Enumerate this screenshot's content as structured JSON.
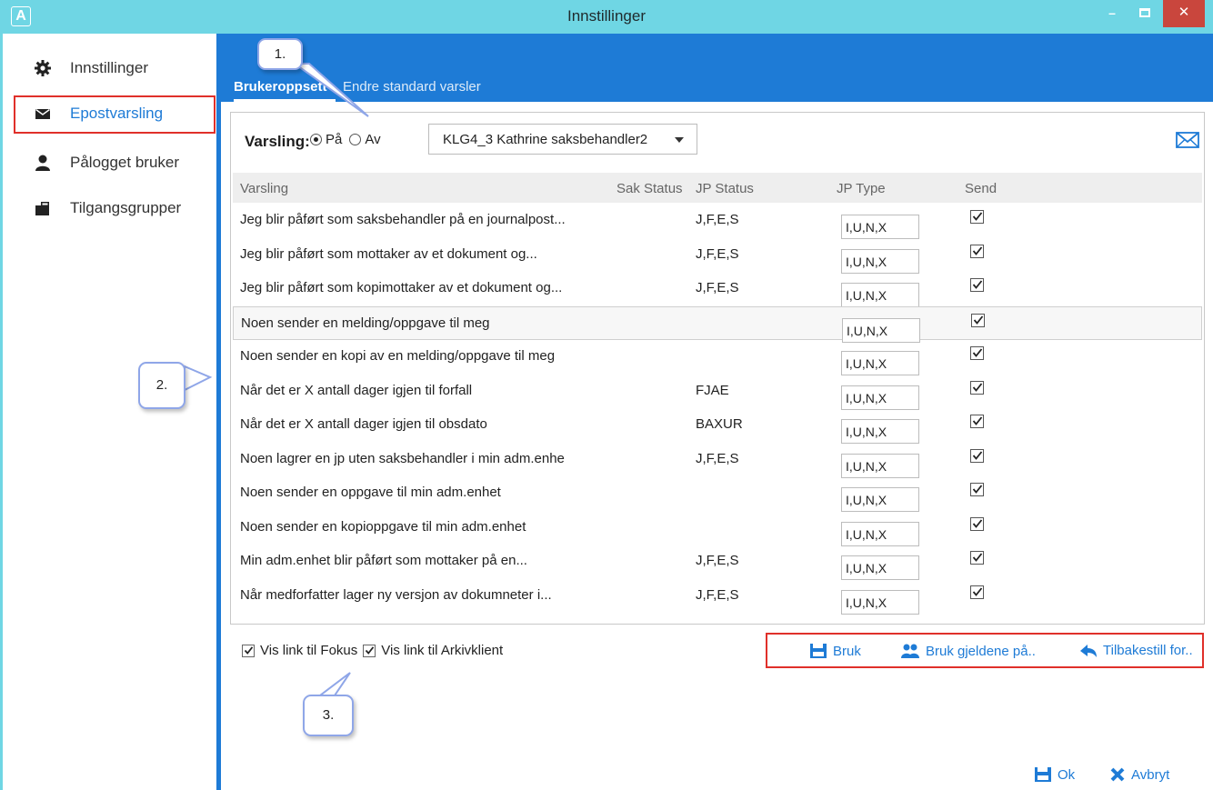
{
  "window": {
    "app_icon": "A",
    "title": "Innstillinger",
    "minimize": "–",
    "close": "✕"
  },
  "sidebar": {
    "items": [
      {
        "label": "Innstillinger",
        "icon": "gear-icon"
      },
      {
        "label": "Epostvarsling",
        "icon": "envelope-icon",
        "active": true
      },
      {
        "label": "Pålogget bruker",
        "icon": "user-icon"
      },
      {
        "label": "Tilgangsgrupper",
        "icon": "group-icon"
      }
    ]
  },
  "tabs": [
    {
      "label": "Brukeroppsett",
      "active": true
    },
    {
      "label": "Endre standard varsler"
    }
  ],
  "varsling": {
    "label": "Varsling:",
    "on_label": "På",
    "off_label": "Av",
    "selected": "på",
    "user": "KLG4_3  Kathrine saksbehandler2"
  },
  "table": {
    "headers": [
      "Varsling",
      "Sak Status",
      "JP Status",
      "JP Type",
      "Send"
    ],
    "rows": [
      {
        "text": "Jeg blir påført som saksbehandler på en journalpost...",
        "jp_status": "J,F,E,S",
        "jp_type": "I,U,N,X",
        "send": true
      },
      {
        "text": "Jeg blir påført som mottaker av et dokument og...",
        "jp_status": "J,F,E,S",
        "jp_type": "I,U,N,X",
        "send": true
      },
      {
        "text": "Jeg blir påført som kopimottaker av et dokument og...",
        "jp_status": "J,F,E,S",
        "jp_type": "I,U,N,X",
        "send": true
      },
      {
        "text": "Noen sender en melding/oppgave til meg",
        "jp_status": "",
        "jp_type": "I,U,N,X",
        "send": true,
        "highlight": true
      },
      {
        "text": "Noen sender en kopi av en melding/oppgave til meg",
        "jp_status": "",
        "jp_type": "I,U,N,X",
        "send": true
      },
      {
        "text": "Når det er X antall dager igjen til forfall",
        "jp_status": "FJAE",
        "jp_type": "I,U,N,X",
        "send": true
      },
      {
        "text": "Når det er X antall dager igjen til obsdato",
        "jp_status": "BAXUR",
        "jp_type": "I,U,N,X",
        "send": true
      },
      {
        "text": "Noen lagrer en jp uten saksbehandler i min adm.enhe",
        "jp_status": "J,F,E,S",
        "jp_type": "I,U,N,X",
        "send": true
      },
      {
        "text": "Noen sender en oppgave til min adm.enhet",
        "jp_status": "",
        "jp_type": "I,U,N,X",
        "send": true
      },
      {
        "text": "Noen sender en kopioppgave til min adm.enhet",
        "jp_status": "",
        "jp_type": "I,U,N,X",
        "send": true
      },
      {
        "text": "Min adm.enhet blir påført som mottaker på en...",
        "jp_status": "J,F,E,S",
        "jp_type": "I,U,N,X",
        "send": true
      },
      {
        "text": "Når medforfatter lager ny versjon av dokumneter i...",
        "jp_status": "J,F,E,S",
        "jp_type": "I,U,N,X",
        "send": true
      }
    ]
  },
  "footer": {
    "link_fokus": "Vis link til Fokus",
    "link_arkiv": "Vis link til Arkivklient",
    "bruk": "Bruk",
    "bruk_gjeldene": "Bruk gjeldene på..",
    "tilbakestill": "Tilbakestill for..",
    "ok": "Ok",
    "avbryt": "Avbryt"
  },
  "callouts": [
    "1.",
    "2.",
    "3."
  ],
  "colors": {
    "titlebar": "#6fd6e4",
    "accent": "#1e7bd6",
    "highlight_border": "#e0302a",
    "close_button": "#c9463d"
  }
}
